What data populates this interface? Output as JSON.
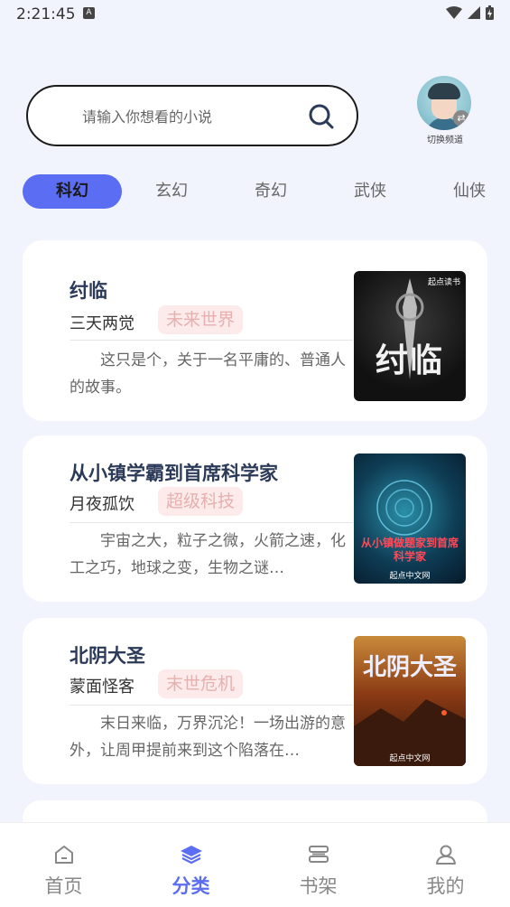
{
  "status": {
    "time": "2:21:45",
    "notif": "A"
  },
  "search": {
    "placeholder": "请输入你想看的小说"
  },
  "channel": {
    "label": "切换频道"
  },
  "tabs": [
    {
      "label": "科幻",
      "active": true
    },
    {
      "label": "玄幻"
    },
    {
      "label": "奇幻"
    },
    {
      "label": "武侠"
    },
    {
      "label": "仙侠"
    }
  ],
  "books": [
    {
      "title": "纣临",
      "author": "三天两觉",
      "tag": "未来世界",
      "description": "这只是个，关于一名平庸的、普通人的故事。",
      "cover_title": "纣临",
      "cover_publisher": "起点读书"
    },
    {
      "title": "从小镇学霸到首席科学家",
      "author": "月夜孤饮",
      "tag": "超级科技",
      "description": "宇宙之大，粒子之微，火箭之速，化工之巧，地球之变，生物之谜…",
      "cover_title": "从小镇做题家到首席科学家",
      "cover_publisher": "起点中文网"
    },
    {
      "title": "北阴大圣",
      "author": "蒙面怪客",
      "tag": "末世危机",
      "description": "末日来临，万界沉沦！一场出游的意外，让周甲提前来到这个陷落在…",
      "cover_title": "北阴大圣",
      "cover_publisher": "起点中文网"
    }
  ],
  "nav": [
    {
      "label": "首页",
      "icon": "home-icon"
    },
    {
      "label": "分类",
      "icon": "layers-icon",
      "active": true
    },
    {
      "label": "书架",
      "icon": "bookshelf-icon"
    },
    {
      "label": "我的",
      "icon": "user-icon"
    }
  ],
  "colors": {
    "accent": "#5b6df2",
    "tag_bg": "#fdeaea",
    "tag_text": "#e7b0b0",
    "background": "#f1f3fd"
  }
}
